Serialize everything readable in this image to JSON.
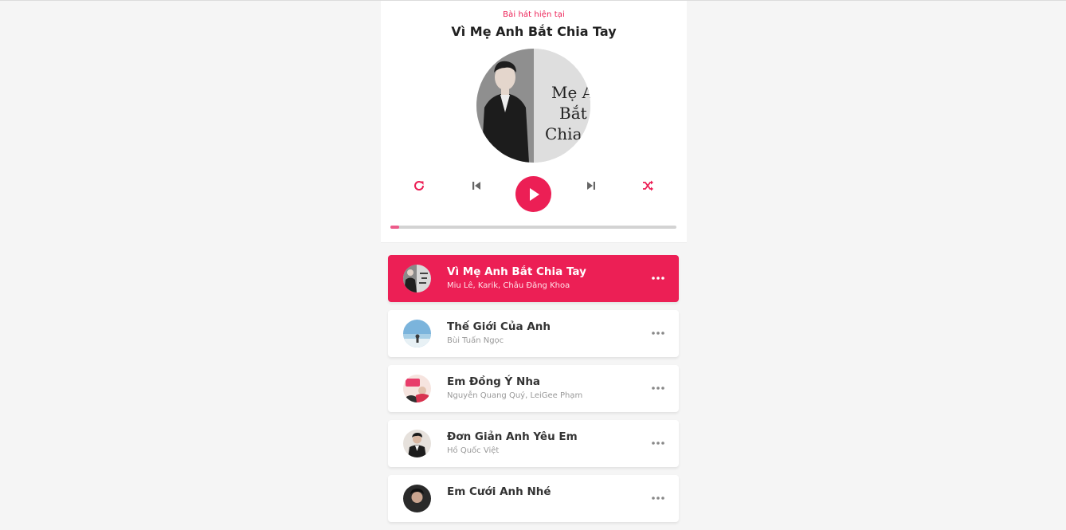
{
  "header": {
    "label": "Bài hát hiện tại",
    "current_title": "Vì Mẹ Anh Bắt Chia Tay"
  },
  "cd_art": {
    "text_lines": [
      "Mẹ A",
      "Bắt",
      "Chia"
    ]
  },
  "controls": {
    "repeat_icon": "repeat-icon",
    "prev_icon": "skip-previous-icon",
    "play_icon": "play-icon",
    "next_icon": "skip-next-icon",
    "random_icon": "shuffle-icon"
  },
  "progress": {
    "value_percent": 3
  },
  "colors": {
    "accent": "#ec1f55",
    "progress_fill": "#ec5b8a",
    "track": "#d3d3d3"
  },
  "playlist": [
    {
      "title": "Vì Mẹ Anh Bắt Chia Tay",
      "singer": "Miu Lê, Karik, Châu Đăng Khoa",
      "active": true
    },
    {
      "title": "Thế Giới Của Anh",
      "singer": "Bùi Tuấn Ngọc",
      "active": false
    },
    {
      "title": "Em Đồng Ý Nha",
      "singer": "Nguyễn Quang Quý, LeiGee Phạm",
      "active": false
    },
    {
      "title": "Đơn Giản Anh Yêu Em",
      "singer": "Hồ Quốc Việt",
      "active": false
    },
    {
      "title": "Em Cưới Anh Nhé",
      "singer": "",
      "active": false
    }
  ]
}
